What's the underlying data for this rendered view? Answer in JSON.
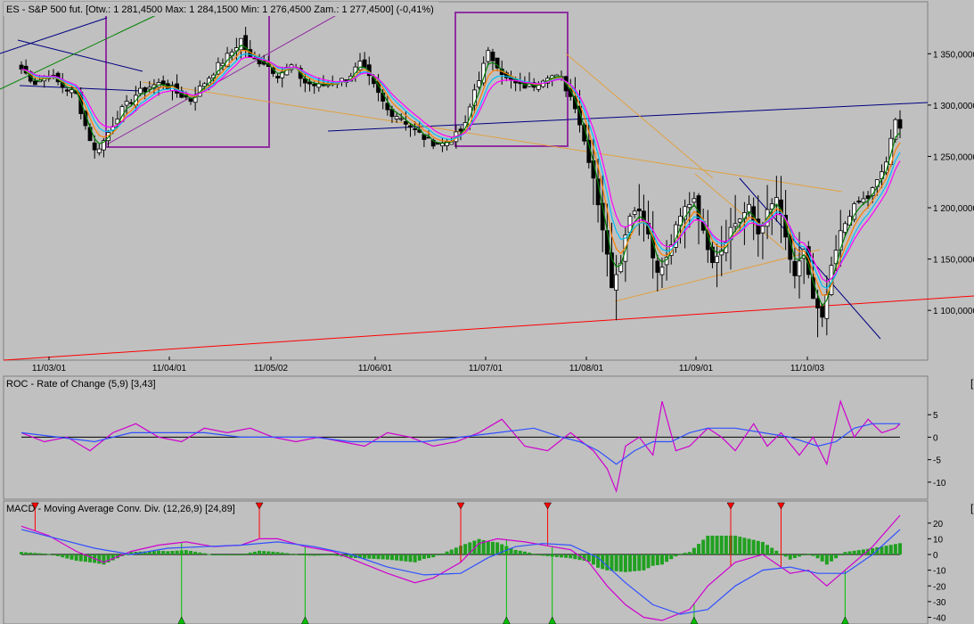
{
  "main": {
    "title": "ES - S&P 500 fut. [Otw.: 1 281,4500  Max: 1 284,1500  Min: 1 276,4500  Zam.: 1 277,4500] (-0,41%)",
    "y_ticks": [
      "1 350,0000",
      "1 300,0000",
      "1 250,0000",
      "1 200,0000",
      "1 150,0000",
      "1 100,0000"
    ],
    "x_ticks": [
      "11/03/01",
      "11/04/01",
      "11/05/02",
      "11/06/01",
      "11/07/01",
      "11/08/01",
      "11/09/01",
      "11/10/03"
    ]
  },
  "roc": {
    "title": "ROC - Rate of Change (5,9) [3,43]",
    "y_ticks": [
      "5",
      "0",
      "-5",
      "-10"
    ]
  },
  "macd": {
    "title": "MACD - Moving Average Conv. Div. (12,26,9) [24,89]",
    "y_ticks": [
      "20",
      "10",
      "0",
      "-10",
      "-20",
      "-30",
      "-40"
    ]
  },
  "colors": {
    "background": "#c0c0c0",
    "bull_candle": "#ffffff",
    "bear_candle": "#000000",
    "ma_fast": "#008000",
    "ma_orange": "#ff8000",
    "ma_cyan": "#00c0ff",
    "ma_magenta": "#ff00ff",
    "macd_line": "#d000d0",
    "signal_line": "#3050ff",
    "histogram": "#20a020",
    "trend_blue": "#000080",
    "trend_red": "#ff0000",
    "trend_tan": "#e0a040",
    "box_purple": "#9030a0",
    "sell_marker": "#ff0000",
    "buy_marker": "#00c000"
  },
  "chart_data": [
    {
      "type": "candlestick",
      "symbol": "ES - S&P 500 fut.",
      "ohlc_last": {
        "open": 1281.45,
        "high": 1284.15,
        "low": 1276.45,
        "close": 1277.45,
        "change_pct": -0.41
      },
      "ylim": [
        1055,
        1385
      ],
      "x_labels": [
        "11/03/01",
        "11/04/01",
        "11/05/02",
        "11/06/01",
        "11/07/01",
        "11/08/01",
        "11/09/01",
        "11/10/03"
      ],
      "close_path": [
        [
          0,
          1335
        ],
        [
          3,
          1322
        ],
        [
          6,
          1330
        ],
        [
          9,
          1318
        ],
        [
          12,
          1310
        ],
        [
          14,
          1280
        ],
        [
          16,
          1255
        ],
        [
          18,
          1265
        ],
        [
          21,
          1290
        ],
        [
          25,
          1310
        ],
        [
          28,
          1318
        ],
        [
          31,
          1322
        ],
        [
          34,
          1312
        ],
        [
          37,
          1305
        ],
        [
          40,
          1322
        ],
        [
          43,
          1338
        ],
        [
          46,
          1352
        ],
        [
          48,
          1364
        ],
        [
          50,
          1345
        ],
        [
          53,
          1342
        ],
        [
          56,
          1330
        ],
        [
          59,
          1338
        ],
        [
          62,
          1322
        ],
        [
          65,
          1318
        ],
        [
          68,
          1322
        ],
        [
          71,
          1325
        ],
        [
          74,
          1340
        ],
        [
          77,
          1318
        ],
        [
          80,
          1295
        ],
        [
          83,
          1288
        ],
        [
          86,
          1275
        ],
        [
          89,
          1265
        ],
        [
          92,
          1262
        ],
        [
          95,
          1270
        ],
        [
          97,
          1280
        ],
        [
          99,
          1315
        ],
        [
          102,
          1350
        ],
        [
          104,
          1340
        ],
        [
          106,
          1325
        ],
        [
          109,
          1318
        ],
        [
          112,
          1320
        ],
        [
          115,
          1330
        ],
        [
          118,
          1325
        ],
        [
          121,
          1300
        ],
        [
          123,
          1265
        ],
        [
          125,
          1230
        ],
        [
          127,
          1180
        ],
        [
          129,
          1125
        ],
        [
          131,
          1150
        ],
        [
          133,
          1195
        ],
        [
          135,
          1200
        ],
        [
          137,
          1175
        ],
        [
          139,
          1135
        ],
        [
          141,
          1150
        ],
        [
          143,
          1180
        ],
        [
          145,
          1200
        ],
        [
          147,
          1210
        ],
        [
          149,
          1175
        ],
        [
          151,
          1150
        ],
        [
          153,
          1160
        ],
        [
          155,
          1180
        ],
        [
          157,
          1190
        ],
        [
          159,
          1200
        ],
        [
          161,
          1175
        ],
        [
          163,
          1195
        ],
        [
          165,
          1210
        ],
        [
          167,
          1170
        ],
        [
          169,
          1130
        ],
        [
          171,
          1160
        ],
        [
          173,
          1110
        ],
        [
          175,
          1090
        ],
        [
          177,
          1140
        ],
        [
          179,
          1175
        ],
        [
          181,
          1195
        ],
        [
          183,
          1205
        ],
        [
          185,
          1210
        ],
        [
          187,
          1225
        ],
        [
          189,
          1245
        ],
        [
          191,
          1284
        ],
        [
          192,
          1278
        ]
      ],
      "indicators": [
        "ma_fast",
        "ma_orange",
        "ma_cyan",
        "ma_magenta"
      ]
    },
    {
      "type": "line",
      "title": "ROC - Rate of Change (5,9) [3,43]",
      "ylim": [
        -13,
        10
      ],
      "series": [
        {
          "name": "ROC",
          "color": "#d000d0",
          "x": [
            0,
            5,
            10,
            15,
            20,
            25,
            30,
            35,
            40,
            45,
            50,
            55,
            60,
            65,
            70,
            75,
            80,
            85,
            90,
            95,
            100,
            105,
            110,
            115,
            120,
            125,
            128,
            130,
            132,
            135,
            138,
            140,
            143,
            146,
            150,
            153,
            156,
            160,
            163,
            166,
            170,
            173,
            176,
            179,
            182,
            185,
            188,
            191,
            192
          ],
          "y": [
            1,
            -1,
            0,
            -3,
            1,
            3,
            0,
            -1,
            2,
            1,
            2,
            0,
            -1,
            0,
            -1,
            -2,
            1,
            0,
            -2,
            -1,
            1,
            4,
            -2,
            -3,
            1,
            -3,
            -7,
            -12,
            -2,
            0,
            -4,
            8,
            -3,
            -2,
            2,
            0,
            -3,
            3,
            -2,
            1,
            -4,
            0,
            -6,
            8,
            0,
            4,
            1,
            2,
            3
          ]
        },
        {
          "name": "Signal",
          "color": "#3050ff",
          "x": [
            0,
            8,
            16,
            24,
            32,
            40,
            48,
            56,
            64,
            72,
            80,
            88,
            96,
            104,
            112,
            118,
            122,
            126,
            130,
            134,
            138,
            142,
            146,
            150,
            156,
            162,
            168,
            174,
            178,
            182,
            186,
            190,
            192
          ],
          "y": [
            1,
            0,
            -1,
            1,
            1,
            1,
            0,
            0,
            0,
            -1,
            -1,
            -1,
            0,
            1,
            2,
            0,
            -1,
            -3,
            -6,
            -3,
            -1,
            -1,
            1,
            2,
            2,
            1,
            0,
            -2,
            -1,
            2,
            3,
            3,
            3
          ]
        }
      ]
    },
    {
      "type": "line",
      "title": "MACD - Moving Average Conv. Div. (12,26,9) [24,89]",
      "ylim": [
        -42,
        25
      ],
      "series": [
        {
          "name": "MACD",
          "color": "#d000d0",
          "x": [
            0,
            6,
            12,
            18,
            24,
            30,
            36,
            42,
            48,
            52,
            56,
            62,
            68,
            74,
            80,
            86,
            90,
            96,
            100,
            104,
            110,
            116,
            120,
            124,
            128,
            132,
            136,
            140,
            146,
            150,
            156,
            162,
            168,
            172,
            176,
            180,
            186,
            192
          ],
          "y": [
            18,
            12,
            2,
            -5,
            2,
            6,
            8,
            5,
            6,
            10,
            10,
            5,
            2,
            -5,
            -12,
            -18,
            -15,
            -5,
            7,
            10,
            8,
            5,
            3,
            -5,
            -20,
            -32,
            -40,
            -42,
            -35,
            -20,
            -5,
            0,
            -12,
            -10,
            -20,
            -10,
            5,
            25
          ]
        },
        {
          "name": "Signal",
          "color": "#3050ff",
          "x": [
            0,
            8,
            16,
            24,
            32,
            40,
            48,
            56,
            64,
            72,
            80,
            88,
            96,
            102,
            108,
            114,
            120,
            126,
            132,
            138,
            144,
            150,
            156,
            162,
            168,
            174,
            180,
            186,
            192
          ],
          "y": [
            16,
            10,
            4,
            0,
            4,
            5,
            6,
            8,
            5,
            0,
            -8,
            -13,
            -12,
            -2,
            5,
            7,
            6,
            -2,
            -18,
            -32,
            -38,
            -35,
            -20,
            -10,
            -8,
            -12,
            -12,
            0,
            16
          ]
        }
      ],
      "sell_signals_x": [
        3,
        52,
        96,
        115,
        155,
        166
      ],
      "buy_signals_x": [
        35,
        62,
        106,
        116,
        147,
        180
      ]
    }
  ]
}
